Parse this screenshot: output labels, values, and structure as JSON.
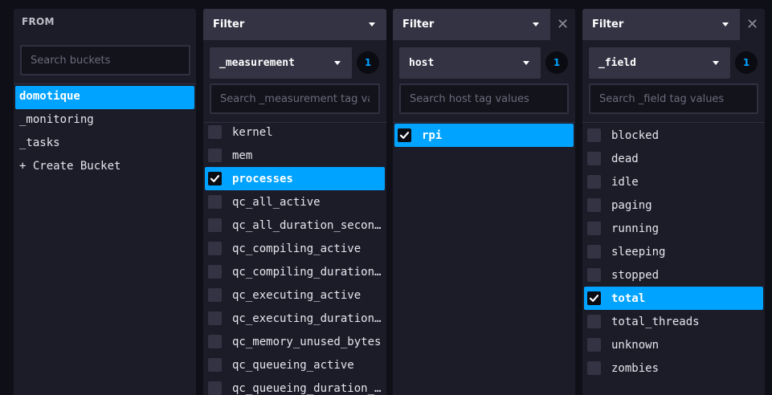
{
  "from": {
    "title": "FROM",
    "search_placeholder": "Search buckets",
    "buckets": [
      {
        "label": "domotique",
        "selected": true
      },
      {
        "label": "_monitoring",
        "selected": false
      },
      {
        "label": "_tasks",
        "selected": false
      },
      {
        "label": "+ Create Bucket",
        "selected": false
      }
    ]
  },
  "filters": [
    {
      "header": "Filter",
      "key": "_measurement",
      "count": "1",
      "search_placeholder": "Search _measurement tag va",
      "closable": false,
      "values": [
        {
          "label": "kernel",
          "checked": false
        },
        {
          "label": "mem",
          "checked": false
        },
        {
          "label": "processes",
          "checked": true
        },
        {
          "label": "qc_all_active",
          "checked": false
        },
        {
          "label": "qc_all_duration_secon…",
          "checked": false
        },
        {
          "label": "qc_compiling_active",
          "checked": false
        },
        {
          "label": "qc_compiling_duration…",
          "checked": false
        },
        {
          "label": "qc_executing_active",
          "checked": false
        },
        {
          "label": "qc_executing_duration…",
          "checked": false
        },
        {
          "label": "qc_memory_unused_bytes",
          "checked": false
        },
        {
          "label": "qc_queueing_active",
          "checked": false
        },
        {
          "label": "qc_queueing_duration_…",
          "checked": false
        }
      ]
    },
    {
      "header": "Filter",
      "key": "host",
      "count": "1",
      "search_placeholder": "Search host tag values",
      "closable": true,
      "values": [
        {
          "label": "rpi",
          "checked": true
        }
      ]
    },
    {
      "header": "Filter",
      "key": "_field",
      "count": "1",
      "search_placeholder": "Search _field tag values",
      "closable": true,
      "values": [
        {
          "label": "blocked",
          "checked": false
        },
        {
          "label": "dead",
          "checked": false
        },
        {
          "label": "idle",
          "checked": false
        },
        {
          "label": "paging",
          "checked": false
        },
        {
          "label": "running",
          "checked": false
        },
        {
          "label": "sleeping",
          "checked": false
        },
        {
          "label": "stopped",
          "checked": false
        },
        {
          "label": "total",
          "checked": true
        },
        {
          "label": "total_threads",
          "checked": false
        },
        {
          "label": "unknown",
          "checked": false
        },
        {
          "label": "zombies",
          "checked": false
        }
      ]
    }
  ],
  "icons": {
    "close": "close-icon",
    "dropdown": "chevron-down-icon",
    "check": "check-icon"
  },
  "colors": {
    "accent": "#00a3ff",
    "panel": "#1c1c28",
    "header": "#333344",
    "background": "#0f0f17"
  }
}
